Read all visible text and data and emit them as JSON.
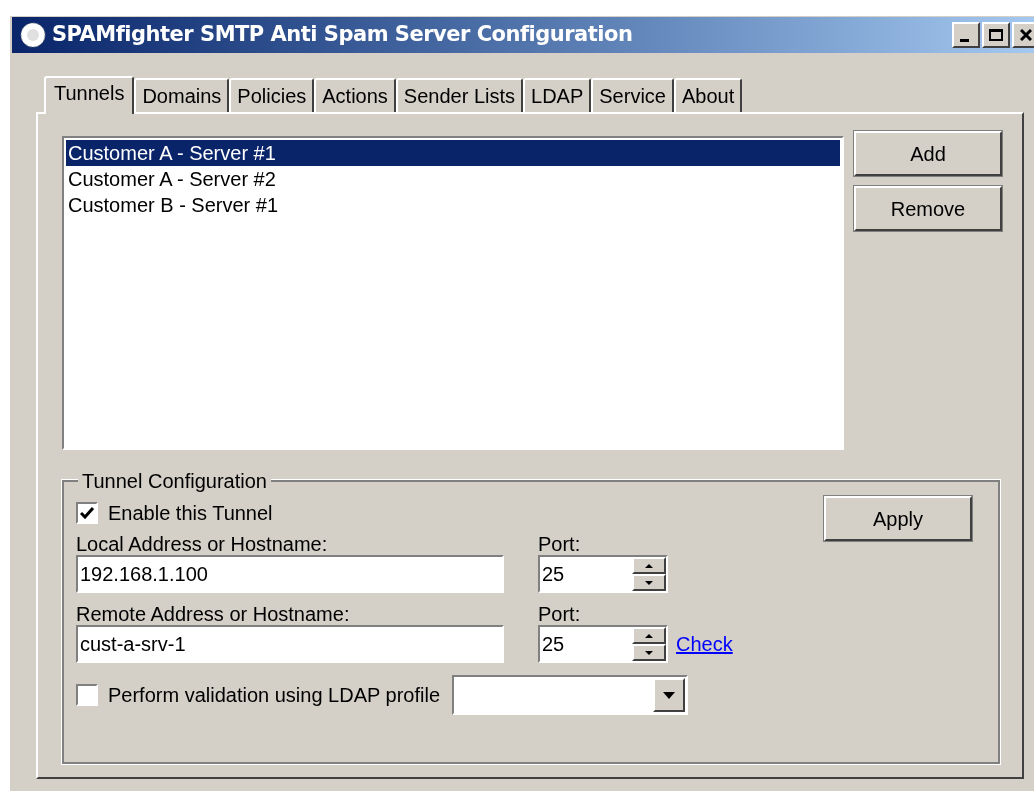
{
  "window": {
    "title": "SPAMfighter SMTP Anti Spam Server Configuration"
  },
  "tabs": [
    {
      "label": "Tunnels",
      "selected": true
    },
    {
      "label": "Domains",
      "selected": false
    },
    {
      "label": "Policies",
      "selected": false
    },
    {
      "label": "Actions",
      "selected": false
    },
    {
      "label": "Sender Lists",
      "selected": false
    },
    {
      "label": "LDAP",
      "selected": false
    },
    {
      "label": "Service",
      "selected": false
    },
    {
      "label": "About",
      "selected": false
    }
  ],
  "tunnels": [
    {
      "label": "Customer A - Server #1",
      "selected": true
    },
    {
      "label": "Customer A - Server #2",
      "selected": false
    },
    {
      "label": "Customer B - Server #1",
      "selected": false
    }
  ],
  "list_buttons": [
    "Add",
    "Remove"
  ],
  "tunnel_configuration": {
    "title": "Tunnel Configuration",
    "enable": {
      "label": "Enable this Tunnel",
      "checked": true
    },
    "apply_button": "Apply",
    "local": {
      "label": "Local Address or Hostname:",
      "value": "192.168.1.100",
      "port_label": "Port:",
      "port": "25"
    },
    "remote": {
      "label": "Remote Address or Hostname:",
      "value": "cust-a-srv-1",
      "port_label": "Port:",
      "port": "25",
      "link": "Check"
    },
    "ldap": {
      "label": "Perform validation using LDAP profile",
      "checked": false
    }
  }
}
